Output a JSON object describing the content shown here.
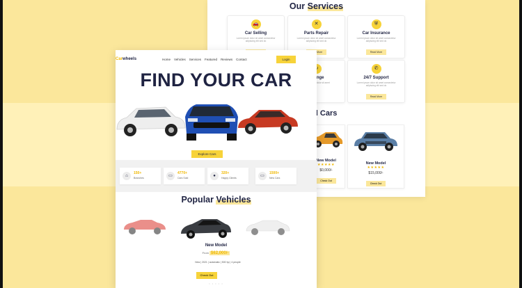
{
  "back_page": {
    "services_title_plain": "Our",
    "services_title_hl": "Services",
    "services": [
      {
        "icon": "car-icon",
        "title": "Car Selling",
        "desc": "Lorem ipsum dolor sit amet consectetur adipiscing elit sed do",
        "button": "Read More"
      },
      {
        "icon": "wrench-icon",
        "title": "Parts Repair",
        "desc": "Lorem ipsum dolor sit amet consectetur adipiscing elit sed do",
        "button": "Read More"
      },
      {
        "icon": "shield-icon",
        "title": "Car Insurance",
        "desc": "Lorem ipsum dolor sit amet consectetur adipiscing elit sed do",
        "button": "Read More"
      },
      {
        "icon": "refresh-icon",
        "title": "Change",
        "desc": "Lorem ipsum dolor sit amet",
        "button": ""
      },
      {
        "icon": "phone-icon",
        "title": "24/7 Support",
        "desc": "Lorem ipsum dolor sit amet consectetur adipiscing elit sed do",
        "button": "Read More"
      }
    ],
    "featured_title": "ed Cars",
    "featured": [
      {
        "name": "New Model",
        "stars": "★★★★★",
        "price": "$0,000/-",
        "button": "Check Out"
      },
      {
        "name": "New Model",
        "stars": "★★★★★",
        "price": "$15,000/-",
        "button": "Check Out"
      }
    ]
  },
  "front_page": {
    "logo_accent": "Car",
    "logo_text": "wheels",
    "menu": [
      "Home",
      "Vehicles",
      "Services",
      "Featured",
      "Reviews",
      "Contact"
    ],
    "login": "Login",
    "hero_title": "FIND YOUR CAR",
    "explore_button": "Explore Cars",
    "stats": [
      {
        "icon": "home-icon",
        "number": "150+",
        "label": "Branches"
      },
      {
        "icon": "car-icon",
        "number": "4770+",
        "label": "Cars Sold"
      },
      {
        "icon": "users-icon",
        "number": "320+",
        "label": "Happy Clients"
      },
      {
        "icon": "car-icon",
        "number": "1500+",
        "label": "New Cars"
      }
    ],
    "popular_title_plain": "Popular",
    "popular_title_hl": "Vehicles",
    "vehicle_name": "New Model",
    "price_prefix": "From",
    "price_value": "$62,000/-",
    "features": "New | 2021 | automatic | 500 hp | 4 people",
    "check_button": "Check Out",
    "dots": "• • • • •"
  },
  "colors": {
    "background": "#fbe79b",
    "accent": "#f7d33a",
    "heading": "#1f2342"
  }
}
